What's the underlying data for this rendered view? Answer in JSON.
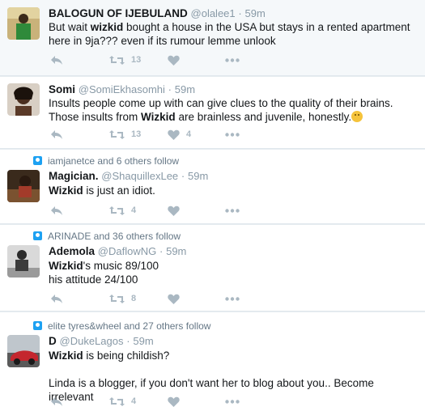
{
  "tweets": [
    {
      "name": "BALOGUN OF IJEBULAND",
      "handle": "@olalee1",
      "time": "59m",
      "context": "",
      "text_parts": [
        "But wait ",
        "wizkid",
        " bought a house in the USA but stays in a rented apartment here in 9ja??? even if its rumour lemme unlook"
      ],
      "retweets": "13",
      "likes": ""
    },
    {
      "name": "Somi",
      "handle": "@SomiEkhasomhi",
      "time": "59m",
      "context": "",
      "text_parts": [
        "Insults people come up with can give clues to the quality of their brains. Those insults from ",
        "Wizkid",
        " are brainless and juvenile, honestly."
      ],
      "retweets": "13",
      "likes": "4"
    },
    {
      "name": "Magician.",
      "handle": "@ShaquillexLee",
      "time": "59m",
      "context": "iamjanetce and 6 others follow",
      "text_parts": [
        "Wizkid",
        " is just an idiot."
      ],
      "retweets": "4",
      "likes": ""
    },
    {
      "name": "Ademola",
      "handle": "@DaflowNG",
      "time": "59m",
      "context": "ARINADE and 36 others follow",
      "text_parts": [
        "Wizkid",
        "'s music 89/100",
        "his attitude 24/100"
      ],
      "retweets": "8",
      "likes": ""
    },
    {
      "name": "D",
      "handle": "@DukeLagos",
      "time": "59m",
      "context": "elite tyres&wheel and 27 others follow",
      "text_parts": [
        "Wizkid",
        " is being childish?",
        "Linda is a blogger, if you don't want her to blog about you.. Become irrelevant"
      ],
      "retweets": "4",
      "likes": ""
    }
  ],
  "separator": "·",
  "icons": {
    "reply": "reply-icon",
    "retweet": "retweet-icon",
    "like": "heart-icon",
    "more": "more-icon",
    "context": "follow-context-icon"
  },
  "colors": {
    "action": "#aab8c2",
    "secondary": "#8899a6",
    "accent": "#1da1f2"
  }
}
